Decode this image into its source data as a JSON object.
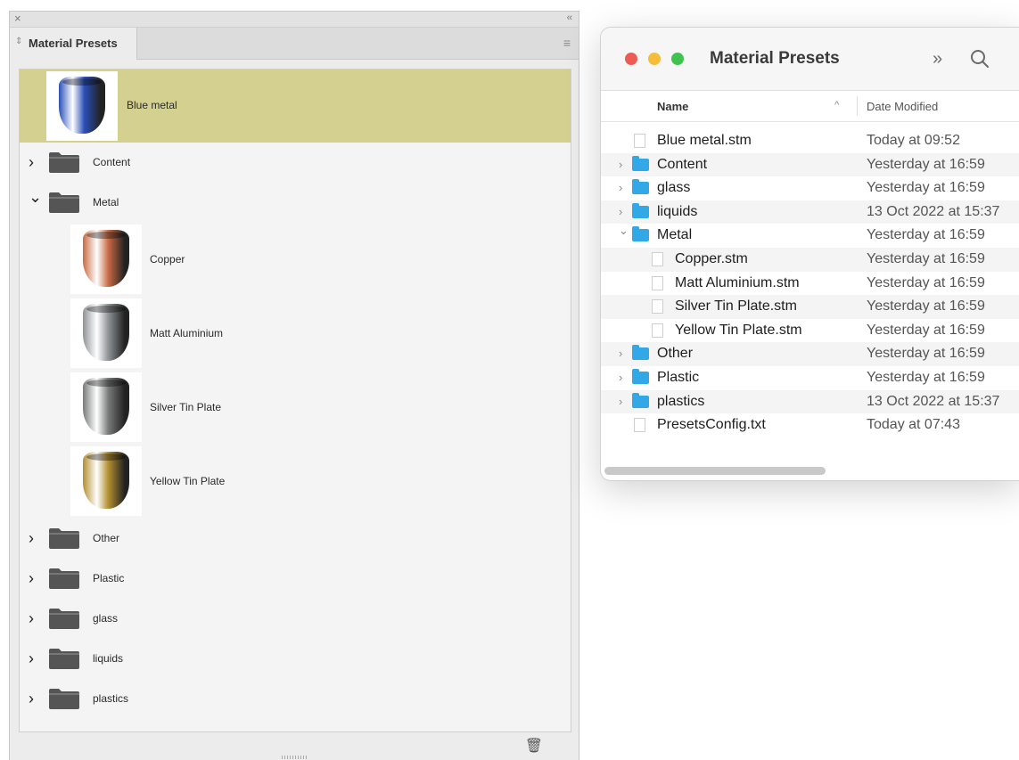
{
  "panel": {
    "close_glyph": "×",
    "collapse_glyph": "‹‹",
    "tab_label": "Material Presets",
    "tab_arrows": "⇕",
    "menu_glyph": "≡",
    "trash_glyph": "🗑",
    "items": [
      {
        "label": "Blue metal",
        "kind": "preset",
        "selected": true,
        "color": "#2a4fb8"
      },
      {
        "label": "Content",
        "kind": "folder",
        "expanded": false
      },
      {
        "label": "Metal",
        "kind": "folder",
        "expanded": true
      },
      {
        "label": "Copper",
        "kind": "preset",
        "color": "#c86a43"
      },
      {
        "label": "Matt Aluminium",
        "kind": "preset",
        "color": "#8e9396"
      },
      {
        "label": "Silver Tin Plate",
        "kind": "preset",
        "color": "#777a78"
      },
      {
        "label": "Yellow Tin Plate",
        "kind": "preset",
        "color": "#b38e2f"
      },
      {
        "label": "Other",
        "kind": "folder",
        "expanded": false
      },
      {
        "label": "Plastic",
        "kind": "folder",
        "expanded": false
      },
      {
        "label": "glass",
        "kind": "folder",
        "expanded": false
      },
      {
        "label": "liquids",
        "kind": "folder",
        "expanded": false
      },
      {
        "label": "plastics",
        "kind": "folder",
        "expanded": false
      }
    ],
    "selection_color": "#d4d190",
    "folder_color": "#555555"
  },
  "finder": {
    "title": "Material Presets",
    "more_glyph": "»",
    "columns": {
      "name": "Name",
      "date": "Date Modified",
      "sort_glyph": "^"
    },
    "rows": [
      {
        "name": "Blue metal.stm",
        "date": "Today at 09:52",
        "kind": "file",
        "level": 0
      },
      {
        "name": "Content",
        "date": "Yesterday at 16:59",
        "kind": "folder",
        "level": 0,
        "chevron": ">"
      },
      {
        "name": "glass",
        "date": "Yesterday at 16:59",
        "kind": "folder",
        "level": 0,
        "chevron": ">"
      },
      {
        "name": "liquids",
        "date": "13 Oct 2022 at 15:37",
        "kind": "folder",
        "level": 0,
        "chevron": ">"
      },
      {
        "name": "Metal",
        "date": "Yesterday at 16:59",
        "kind": "folder",
        "level": 0,
        "chevron": "v"
      },
      {
        "name": "Copper.stm",
        "date": "Yesterday at 16:59",
        "kind": "file",
        "level": 1
      },
      {
        "name": "Matt Aluminium.stm",
        "date": "Yesterday at 16:59",
        "kind": "file",
        "level": 1
      },
      {
        "name": "Silver Tin Plate.stm",
        "date": "Yesterday at 16:59",
        "kind": "file",
        "level": 1
      },
      {
        "name": "Yellow Tin Plate.stm",
        "date": "Yesterday at 16:59",
        "kind": "file",
        "level": 1
      },
      {
        "name": "Other",
        "date": "Yesterday at 16:59",
        "kind": "folder",
        "level": 0,
        "chevron": ">"
      },
      {
        "name": "Plastic",
        "date": "Yesterday at 16:59",
        "kind": "folder",
        "level": 0,
        "chevron": ">"
      },
      {
        "name": "plastics",
        "date": "13 Oct 2022 at 15:37",
        "kind": "folder",
        "level": 0,
        "chevron": ">"
      },
      {
        "name": "PresetsConfig.txt",
        "date": "Today at 07:43",
        "kind": "file",
        "level": 0
      }
    ],
    "traffic_lights": {
      "close": "#ee5b52",
      "minimize": "#f5bd3a",
      "zoom": "#3fc24e"
    },
    "folder_color": "#32a8e6"
  }
}
